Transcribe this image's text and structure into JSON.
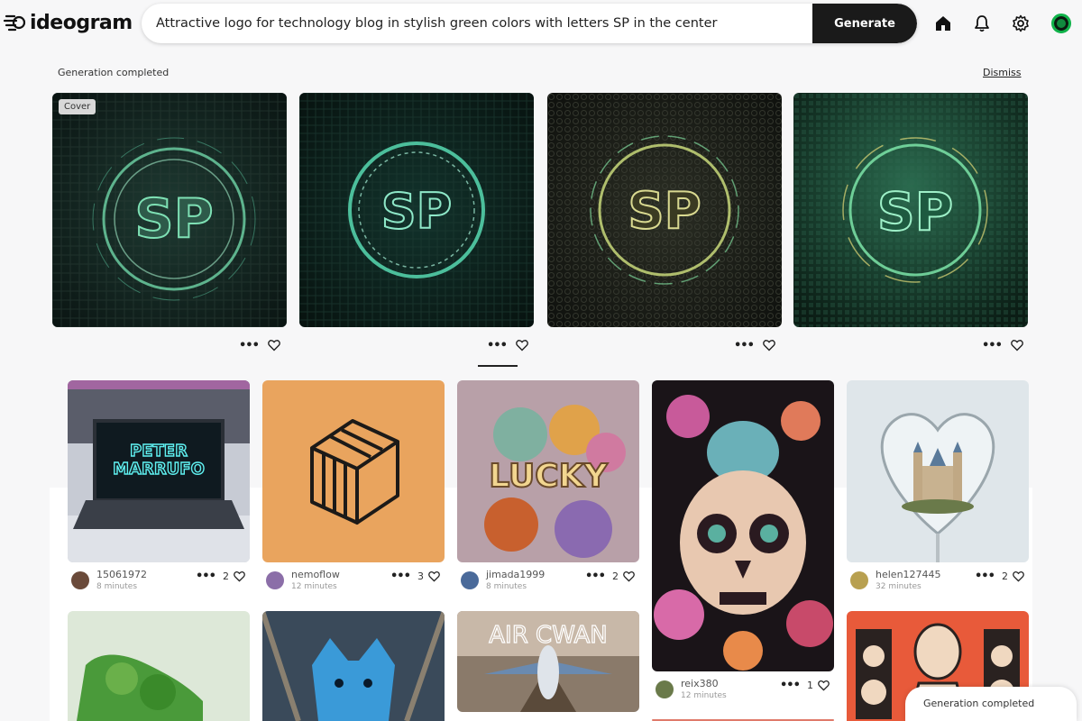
{
  "app": {
    "name": "ideogram"
  },
  "search": {
    "value": "Attractive logo for technology blog in stylish green colors with letters SP in the center",
    "generate_label": "Generate"
  },
  "header_icons": [
    "home-icon",
    "bell-icon",
    "gear-icon",
    "status-dot"
  ],
  "generation": {
    "status": "Generation completed",
    "dismiss_label": "Dismiss",
    "cover_label": "Cover",
    "images": [
      {
        "text": "SP",
        "desc": "circuit-ring"
      },
      {
        "text": "SP",
        "desc": "glow-ring"
      },
      {
        "text": "SP",
        "desc": "gold-ring"
      },
      {
        "text": "SP",
        "desc": "green-ring"
      }
    ]
  },
  "feed": [
    {
      "user": "15061972",
      "time": "8 minutes",
      "likes": "2",
      "image_text": "PETER\nMARRUFO"
    },
    {
      "user": "nemoflow",
      "time": "12 minutes",
      "likes": "3"
    },
    {
      "user": "jimada1999",
      "time": "8 minutes",
      "likes": "2",
      "image_text": "LUCKY"
    },
    {
      "user": "reix380",
      "time": "12 minutes",
      "likes": "1"
    },
    {
      "user": "helen127445",
      "time": "32 minutes",
      "likes": "2"
    },
    {
      "image_text": ""
    },
    {
      "image_text": ""
    },
    {
      "image_text": "AIR CWAN"
    },
    {
      "image_text": ""
    }
  ],
  "toast": "Generation completed",
  "colors": {
    "accent": "#1a1a1a",
    "status": "#10b34a"
  }
}
